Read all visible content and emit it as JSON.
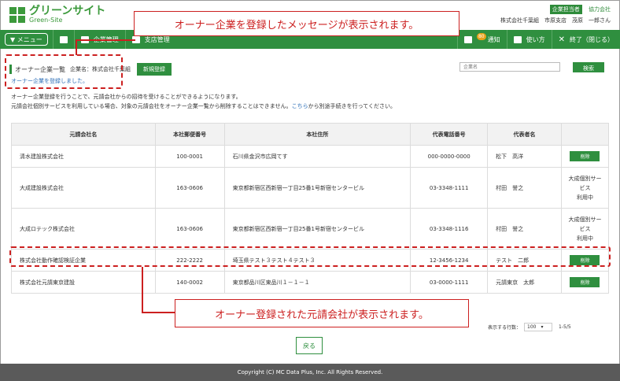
{
  "app": {
    "logo": "グリーンサイト",
    "logo_sub": "Green-Site"
  },
  "header": {
    "role_badge": "企業担当者",
    "partner_label": "協力会社",
    "user_info": "株式会社千葉組　市原支店　茂原　一郎さん"
  },
  "nav": {
    "menu": "▼ メニュー",
    "company_mgmt": "企業管理",
    "branch_mgmt": "支店管理",
    "notif_count": "80",
    "notif": "通知",
    "howto": "使い方",
    "exit": "終了（閉じる）"
  },
  "page": {
    "title": "オーナー企業一覧",
    "company_label": "企業名：株式会社千葉組",
    "new_button": "新規登録",
    "search_placeholder": "企業名",
    "search_button": "検索",
    "success": "オーナー企業を登録しました。",
    "info1": "オーナー企業登録を行うことで、元請会社からの招待を受けることができるようになります。",
    "info2_pre": "元請会社個別サービスを利用している場合、対象の元請会社をオーナー企業一覧から削除することはできません。",
    "info2_link": "こちら",
    "info2_post": "から別途手続きを行ってください。"
  },
  "table": {
    "headers": [
      "元請会社名",
      "本社郵便番号",
      "本社住所",
      "代表電話番号",
      "代表者名",
      ""
    ],
    "rows": [
      {
        "name": "清水建設株式会社",
        "zip": "100-0001",
        "address": "石川県金沢市広岡てす",
        "phone": "000-0000-0000",
        "rep": "松下　高洋",
        "action": "削除"
      },
      {
        "name": "大成建設株式会社",
        "zip": "163-0606",
        "address": "東京都新宿区西新宿一丁目25番1号新宿センタービル",
        "phone": "03-3348-1111",
        "rep": "村田　誉之",
        "action": "大成個別サービス利用中"
      },
      {
        "name": "大成ロテック株式会社",
        "zip": "163-0606",
        "address": "東京都新宿区西新宿一丁目25番1号新宿センタービル",
        "phone": "03-3348-1116",
        "rep": "村田　誉之",
        "action": "大成個別サービス利用中"
      },
      {
        "name": "株式会社動作確認検証企業",
        "zip": "222-2222",
        "address": "埼玉県テスト３テスト４テスト３",
        "phone": "12-3456-1234",
        "rep": "テスト　二郎",
        "action": "削除"
      },
      {
        "name": "株式会社元請東京建設",
        "zip": "140-0002",
        "address": "東京都品川区東品川１－１－１",
        "phone": "03-0000-1111",
        "rep": "元請東京　太郎",
        "action": "削除"
      }
    ],
    "action_lines": [
      "大成個別サー",
      "ビス",
      "利用中"
    ]
  },
  "pager": {
    "label": "表示する行数：",
    "rows": "100",
    "range": "1-5/5"
  },
  "back": "戻る",
  "footer": "Copyright (C) MC Data Plus, Inc. All Rights Reserved.",
  "callouts": {
    "top": "オーナー企業を登録したメッセージが表示されます。",
    "bottom": "オーナー登録された元請会社が表示されます。"
  }
}
